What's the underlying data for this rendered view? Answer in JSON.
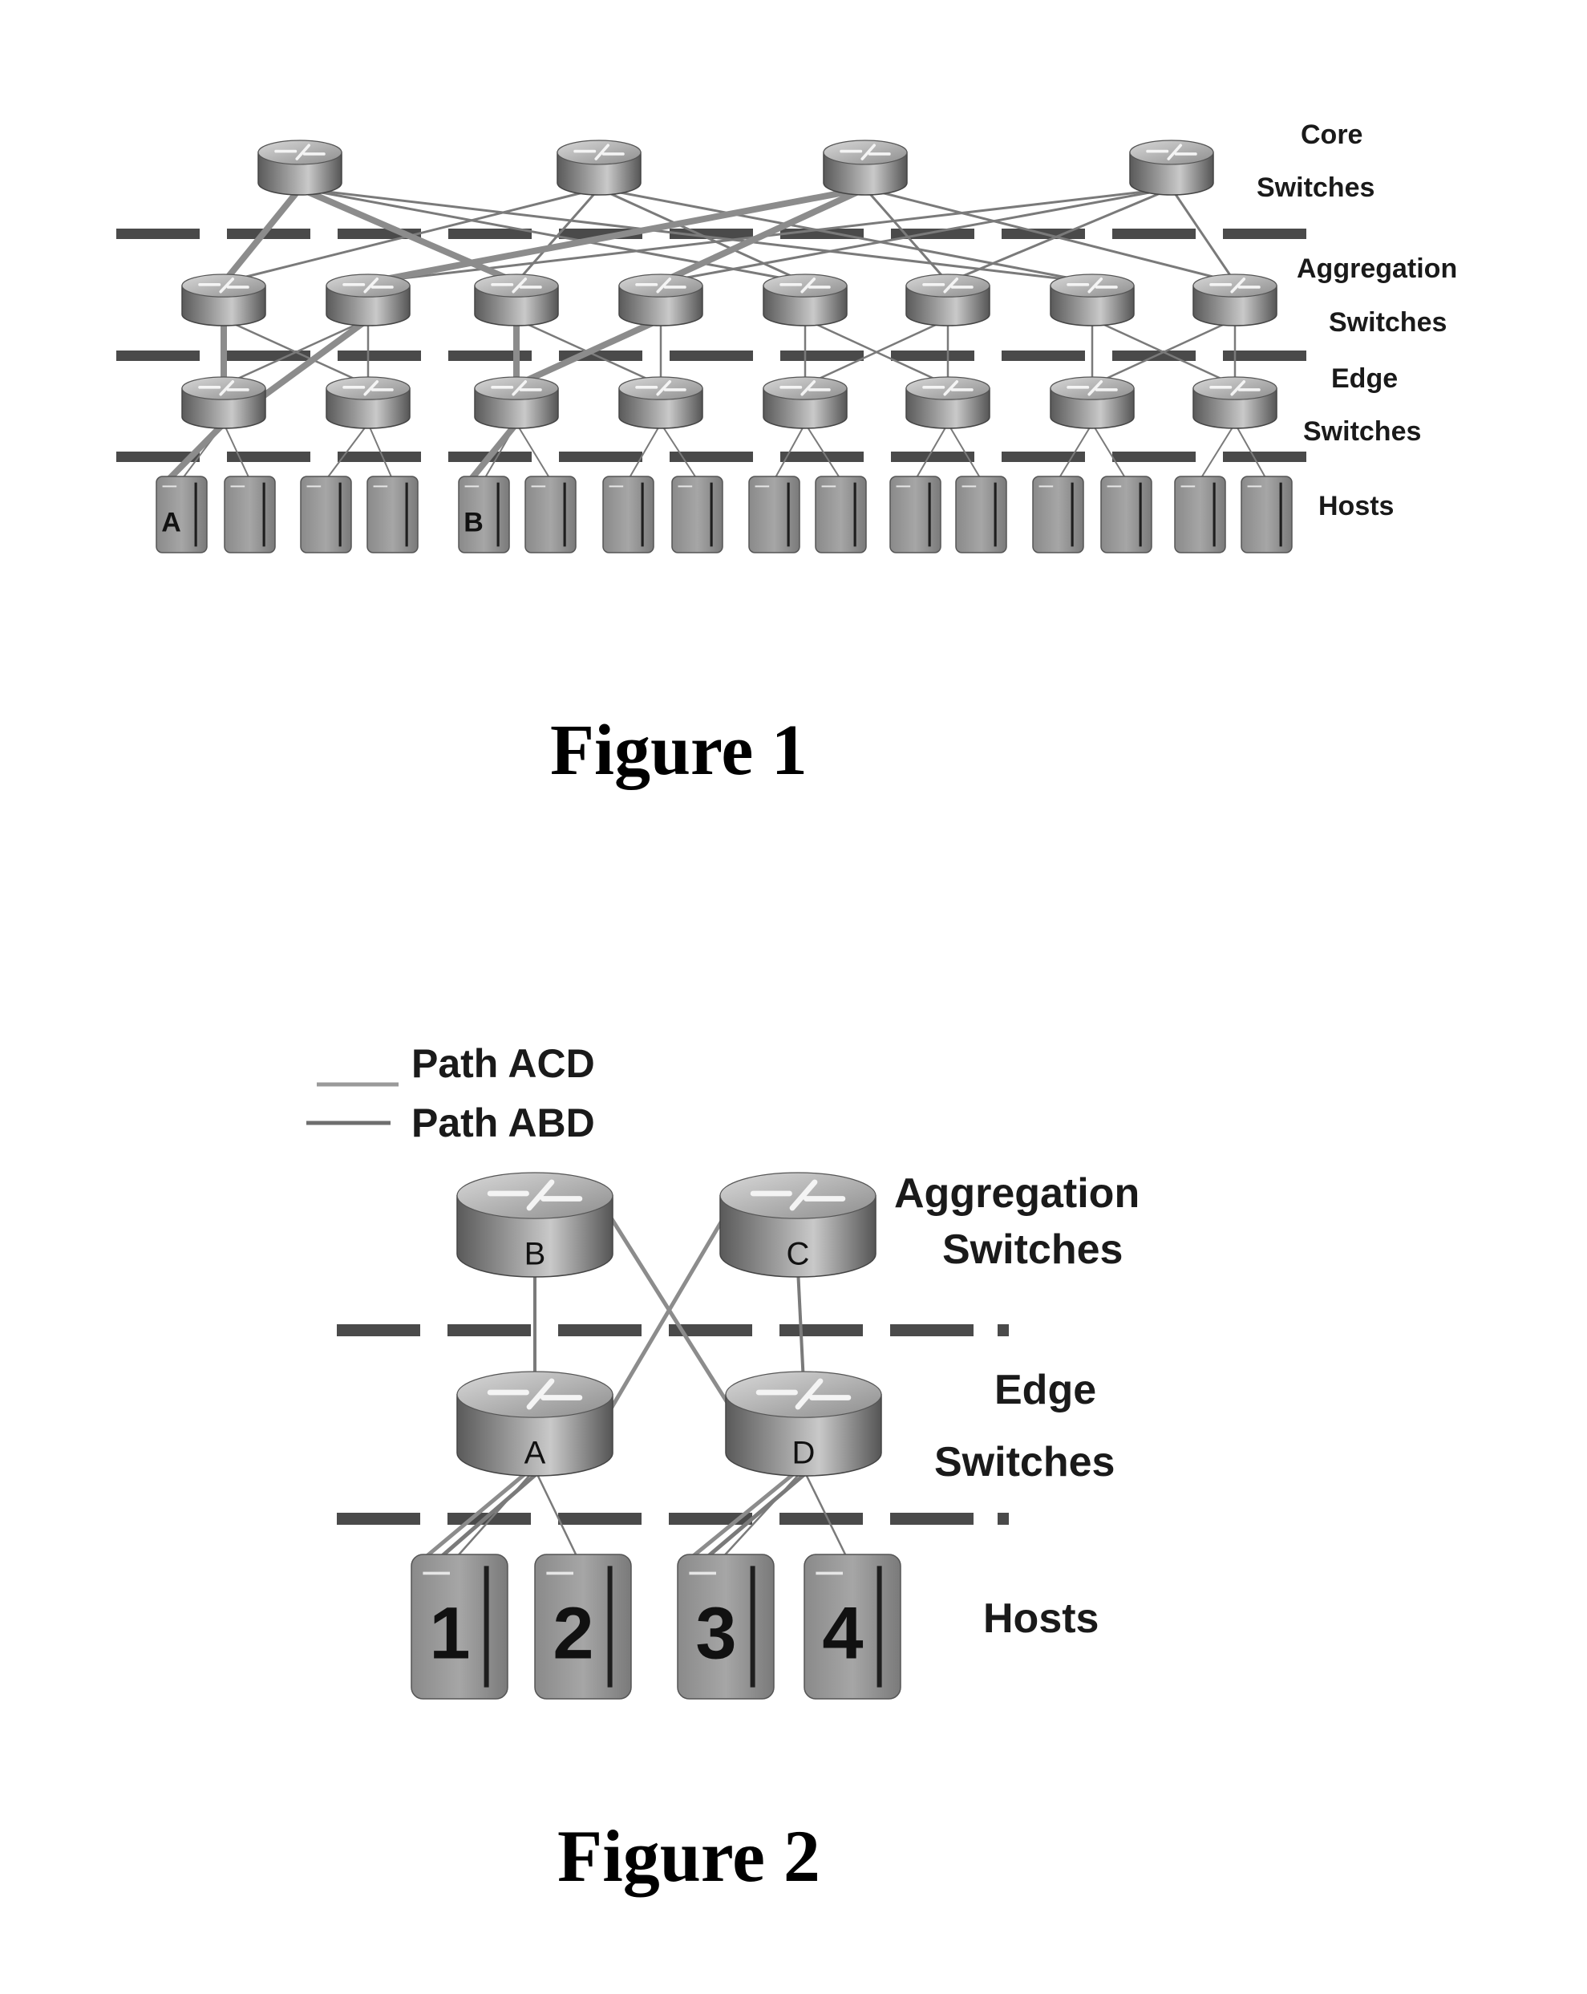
{
  "figure1": {
    "caption": "Figure 1",
    "tier_labels": {
      "core_line1": "Core",
      "core_line2": "Switches",
      "aggregation_line1": "Aggregation",
      "aggregation_line2": "Switches",
      "edge_line1": "Edge",
      "edge_line2": "Switches",
      "hosts": "Hosts"
    },
    "core_switch_count": 4,
    "pods": 4,
    "aggregation_switch_count": 8,
    "edge_switch_count": 8,
    "host_count": 16,
    "host_labels": [
      "A",
      "",
      "",
      "",
      "B",
      "",
      "",
      "",
      "",
      "",
      "",
      "",
      "",
      "",
      "",
      ""
    ]
  },
  "figure2": {
    "caption": "Figure 2",
    "legend": [
      {
        "label": "Path ACD",
        "color": "#9a9a9a"
      },
      {
        "label": "Path ABD",
        "color": "#6e6e6e"
      }
    ],
    "tier_labels": {
      "aggregation_line1": "Aggregation",
      "aggregation_line2": "Switches",
      "edge_line1": "Edge",
      "edge_line2": "Switches",
      "hosts": "Hosts"
    },
    "aggregation_switches": [
      "B",
      "C"
    ],
    "edge_switches": [
      "A",
      "D"
    ],
    "hosts": [
      "1",
      "2",
      "3",
      "4"
    ]
  },
  "colors": {
    "router_top": "#c8c8c8",
    "router_side": "#8a8a8a",
    "host_body": "#9a9a9a",
    "dash": "#4a4a4a",
    "link": "#7a7a7a"
  }
}
